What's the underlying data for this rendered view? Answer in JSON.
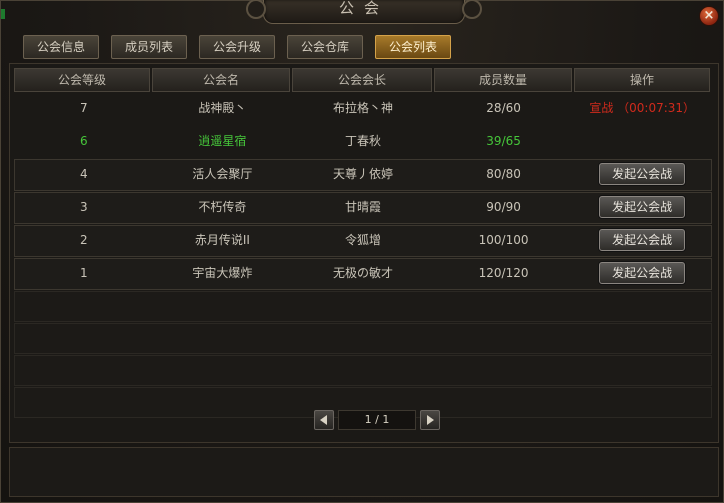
{
  "window": {
    "title": "公会",
    "close_label": "×"
  },
  "tabs": [
    {
      "label": "公会信息",
      "active": false
    },
    {
      "label": "成员列表",
      "active": false
    },
    {
      "label": "公会升级",
      "active": false
    },
    {
      "label": "公会仓库",
      "active": false
    },
    {
      "label": "公会列表",
      "active": true
    }
  ],
  "table": {
    "headers": [
      "公会等级",
      "公会名",
      "公会会长",
      "成员数量",
      "操作"
    ],
    "rows": [
      {
        "level": "7",
        "name": "战神殿丶",
        "leader": "布拉格丶神",
        "members": "28/60",
        "action_text": "宣战 （00:07:31）",
        "action_type": "countdown"
      },
      {
        "level": "6",
        "name": "逍遥星宿",
        "leader": "丁春秋",
        "members": "39/65",
        "action_text": "",
        "action_type": "self"
      },
      {
        "level": "4",
        "name": "活人会聚厅",
        "leader": "天尊丿依婷",
        "members": "80/80",
        "action_text": "发起公会战",
        "action_type": "button"
      },
      {
        "level": "3",
        "name": "不朽传奇",
        "leader": "甘晴霞",
        "members": "90/90",
        "action_text": "发起公会战",
        "action_type": "button"
      },
      {
        "level": "2",
        "name": "赤月传说II",
        "leader": "令狐增",
        "members": "100/100",
        "action_text": "发起公会战",
        "action_type": "button"
      },
      {
        "level": "1",
        "name": "宇宙大爆炸",
        "leader": "无极の敏才",
        "members": "120/120",
        "action_text": "发起公会战",
        "action_type": "button"
      }
    ]
  },
  "pager": {
    "text": "1 / 1"
  },
  "colors": {
    "own_guild": "#46c63a",
    "war": "#d02a1c",
    "active_tab": "#a77a2a"
  }
}
